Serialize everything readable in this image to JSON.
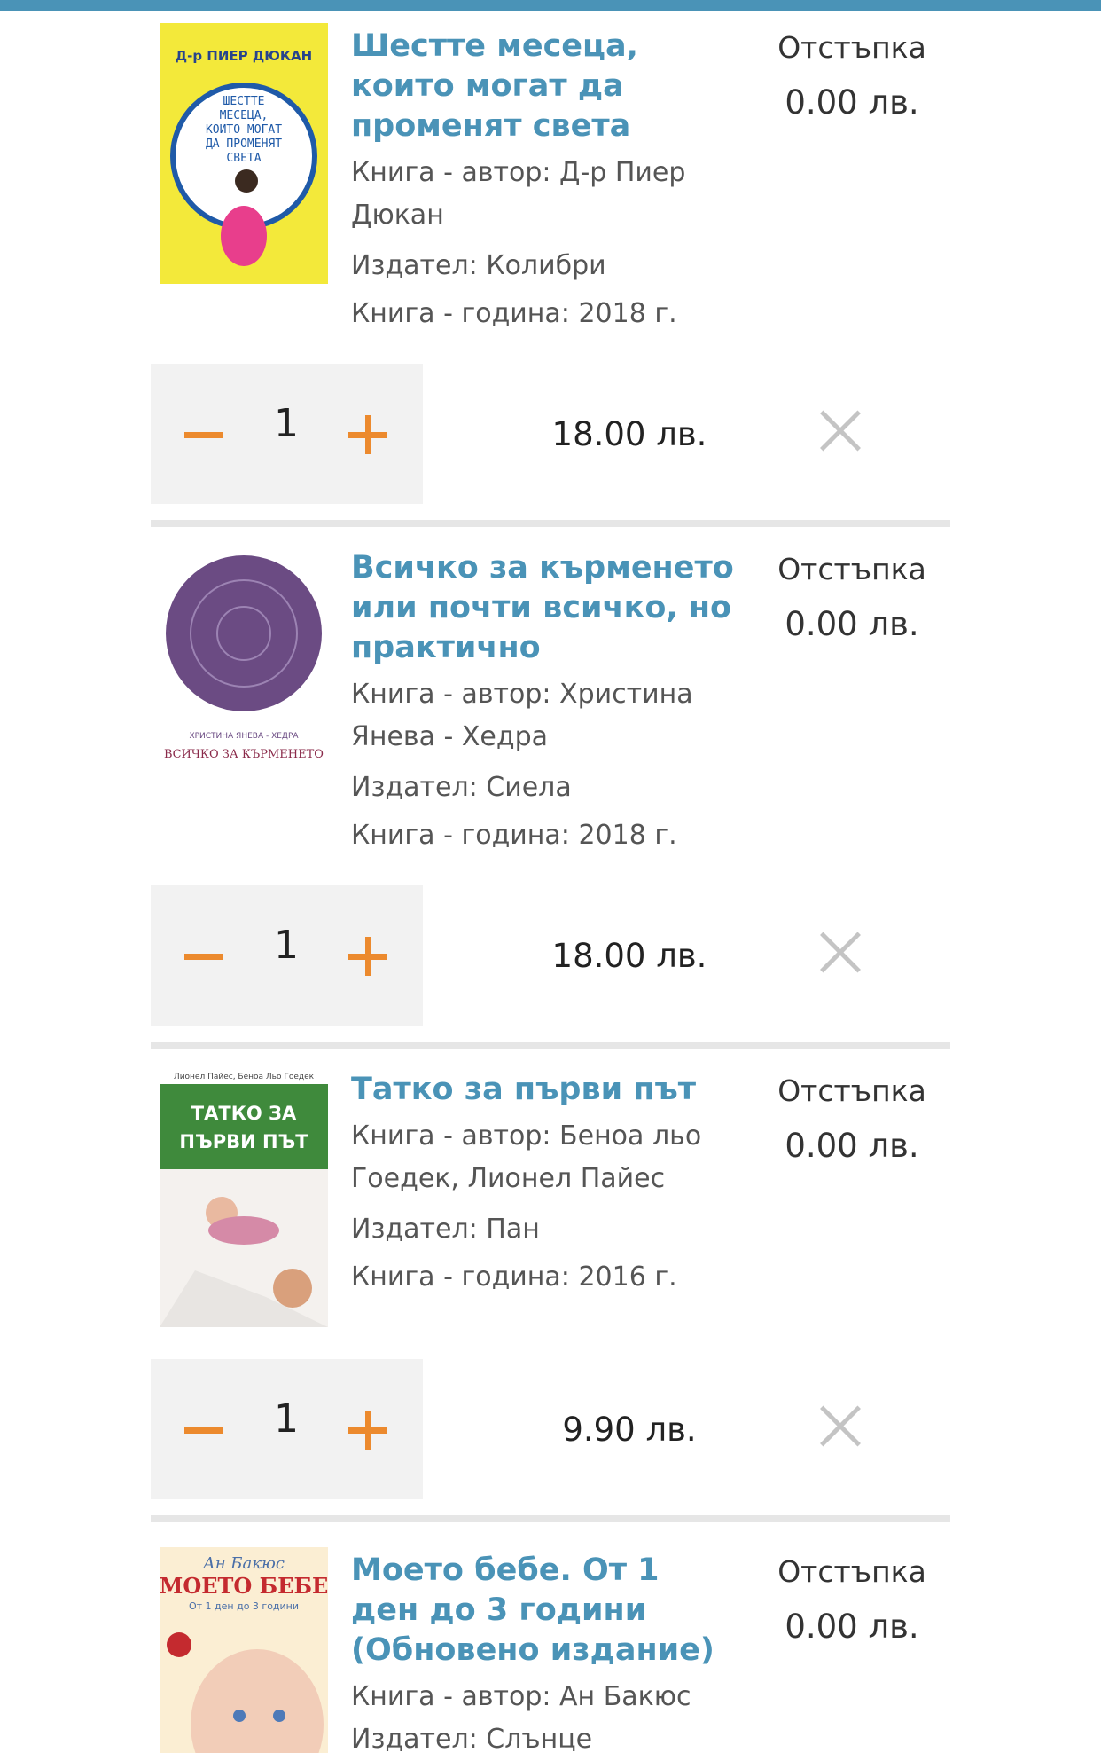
{
  "items": [
    {
      "title": "Шестте месеца, които могат да променят света",
      "author": "Книга - автор: Д-р Пиер Дюкан",
      "publisher": "Издател: Колибри",
      "year": "Книга - година: 2018 г.",
      "discount_label": "Отстъпка",
      "discount_value": "0.00 лв.",
      "quantity": "1",
      "price": "18.00 лв.",
      "cover": {
        "author": "Д-р ПИЕР ДЮКАН",
        "title_lines": [
          "ШЕСТТЕ",
          "МЕСЕЦА,",
          "КОИТО МОГАТ",
          "ДА ПРОМЕНЯТ",
          "СВЕТА"
        ],
        "bg": "#f3e93a"
      }
    },
    {
      "title": "Всичко за кърменето или почти всичко, но практично",
      "author": "Книга - автор: Христина Янева - Хедра",
      "publisher": "Издател: Сиела",
      "year": "Книга - година: 2018 г.",
      "discount_label": "Отстъпка",
      "discount_value": "0.00 лв.",
      "quantity": "1",
      "price": "18.00 лв.",
      "cover": {
        "author": "ХРИСТИНА ЯНЕВА - ХЕДРА",
        "title_lines": [
          "ВСИЧКО ЗА КЪРМЕНЕТО"
        ],
        "bg": "#ffffff"
      }
    },
    {
      "title": "Татко за първи път",
      "author": "Книга - автор: Беноа льо Гоедек, Лионел Пайес",
      "publisher": "Издател: Пан",
      "year": "Книга - година: 2016 г.",
      "discount_label": "Отстъпка",
      "discount_value": "0.00 лв.",
      "quantity": "1",
      "price": "9.90 лв.",
      "cover": {
        "author": "Лионел Пайес, Беноа Льо Гоедек",
        "title_lines": [
          "ТАТКО ЗА",
          "ПЪРВИ ПЪТ"
        ],
        "bg": "#ffffff"
      }
    },
    {
      "title": "Моето бебе. От 1 ден до 3 години (Обновено издание)",
      "author": "Книга - автор: Ан Бакюс",
      "publisher": "Издател: Слънце",
      "discount_label": "Отстъпка",
      "discount_value": "0.00 лв.",
      "cover": {
        "author": "Ан Бакюс",
        "title_lines": [
          "МОЕТО БЕБЕ"
        ],
        "subtitle": "От 1 ден до 3 години",
        "bg": "#fbeed3"
      }
    }
  ],
  "colors": {
    "accent_blue": "#4a93b7",
    "accent_orange": "#ec8a2e",
    "qty_bg": "#f2f2f2"
  }
}
